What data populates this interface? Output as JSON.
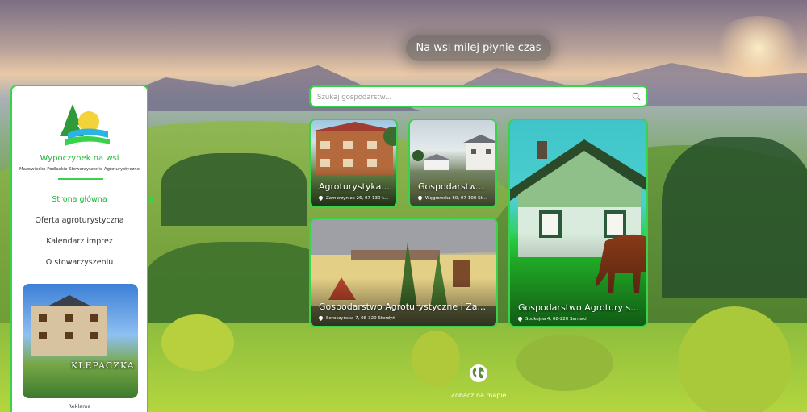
{
  "hero": {
    "tagline": "Na wsi milej płynie czas"
  },
  "sidebar": {
    "brand_name": "Wypoczynek na wsi",
    "brand_subtitle": "Mazowiecko Podlaskie Stowarzyszenie Agroturystyczne",
    "nav": [
      {
        "label": "Strona główna",
        "active": true
      },
      {
        "label": "Oferta agroturystyczna",
        "active": false
      },
      {
        "label": "Kalendarz imprez",
        "active": false
      },
      {
        "label": "O stowarzyszeniu",
        "active": false
      }
    ],
    "ad_image_text": "KLEPACZKA",
    "ad_caption": "Reklama"
  },
  "search": {
    "placeholder": "Szukaj gospodarstw..."
  },
  "cards": [
    {
      "title": "Agroturystyka...",
      "address": "Zambrzyniec 26, 07-130 Ł..."
    },
    {
      "title": "Gospodarstw...",
      "address": "Węgrowska 60, 07-100 St..."
    },
    {
      "title": "Gospodarstwo Agroturystyczne i Za...",
      "address": "Seroczyńska 7, 08-320 Sterdyń"
    },
    {
      "title": "Gospodarstwo Agrotury s...",
      "address": "Spokojna 4, 08-220 Sarnaki"
    }
  ],
  "map_link": {
    "label": "Zobacz na mapie"
  },
  "colors": {
    "accent": "#3ad24a",
    "accent_text": "#24b53a"
  },
  "icons": {
    "search": "search-icon",
    "pin": "map-pin-icon",
    "globe": "globe-icon",
    "logo": "logo-icon"
  }
}
